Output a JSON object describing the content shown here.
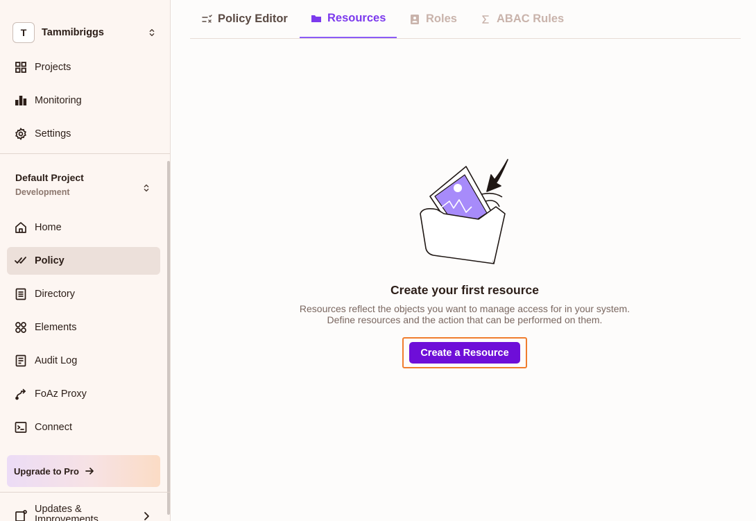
{
  "org": {
    "initial": "T",
    "name": "Tammibriggs"
  },
  "top_nav": [
    {
      "label": "Projects",
      "icon": "grid-icon"
    },
    {
      "label": "Monitoring",
      "icon": "bar-chart-icon"
    },
    {
      "label": "Settings",
      "icon": "gear-icon"
    }
  ],
  "project": {
    "name": "Default Project",
    "environment": "Development"
  },
  "project_nav": [
    {
      "label": "Home",
      "icon": "home-icon"
    },
    {
      "label": "Policy",
      "icon": "check-check-icon",
      "active": true
    },
    {
      "label": "Directory",
      "icon": "directory-icon"
    },
    {
      "label": "Elements",
      "icon": "elements-icon"
    },
    {
      "label": "Audit Log",
      "icon": "document-icon"
    },
    {
      "label": "FoAz Proxy",
      "icon": "route-icon"
    },
    {
      "label": "Connect",
      "icon": "terminal-icon"
    }
  ],
  "upgrade": {
    "label": "Upgrade to Pro"
  },
  "updates": {
    "label": "Updates & Improvements"
  },
  "tabs": [
    {
      "label": "Policy Editor",
      "icon": "sliders-icon"
    },
    {
      "label": "Resources",
      "icon": "folder-icon",
      "active": true
    },
    {
      "label": "Roles",
      "icon": "id-badge-icon"
    },
    {
      "label": "ABAC Rules",
      "icon": "sigma-icon"
    }
  ],
  "empty_state": {
    "title": "Create your first resource",
    "description": "Resources reflect the objects you want to manage access for in your system. Define resources and the action that can be performed on them.",
    "button": "Create a Resource"
  },
  "colors": {
    "accent": "#6e0ed8",
    "tab_active": "#7c3aed",
    "highlight": "#f07d2e"
  }
}
